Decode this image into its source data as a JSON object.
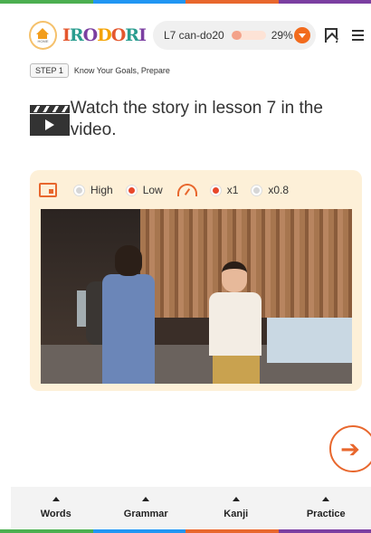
{
  "header": {
    "home_label": "HOME",
    "logo_text": "IRODORI",
    "lesson": "L7 can-do20",
    "progress_percent": 29,
    "progress_text": "29%"
  },
  "step": {
    "badge": "STEP 1",
    "label": "Know Your Goals, Prepare"
  },
  "instruction": {
    "text": "Watch the story in lesson 7 in the video."
  },
  "video_controls": {
    "quality_options": [
      {
        "label": "High",
        "selected": false
      },
      {
        "label": "Low",
        "selected": true
      }
    ],
    "speed_options": [
      {
        "label": "x1",
        "selected": true
      },
      {
        "label": "x0.8",
        "selected": false
      }
    ]
  },
  "bottom_nav": {
    "items": [
      {
        "label": "Words"
      },
      {
        "label": "Grammar"
      },
      {
        "label": "Kanji"
      },
      {
        "label": "Practice"
      }
    ]
  },
  "colors": {
    "accent": "#e8672d",
    "card_bg": "#fdf0d8",
    "rainbow": [
      "#4caf50",
      "#2196f3",
      "#e8672d",
      "#7b3fa1"
    ]
  }
}
